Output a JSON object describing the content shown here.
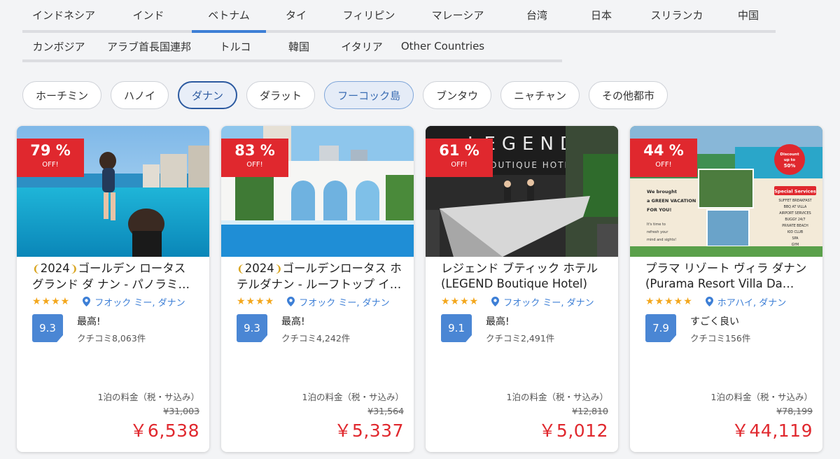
{
  "tabs_row1": [
    {
      "label": "インドネシア"
    },
    {
      "label": "インド"
    },
    {
      "label": "ベトナム",
      "active": true
    },
    {
      "label": "タイ"
    },
    {
      "label": "フィリピン"
    },
    {
      "label": "マレーシア"
    },
    {
      "label": "台湾"
    },
    {
      "label": "日本"
    },
    {
      "label": "スリランカ"
    },
    {
      "label": "中国"
    }
  ],
  "tabs_row2": [
    {
      "label": "カンボジア"
    },
    {
      "label": "アラブ首長国連邦"
    },
    {
      "label": "トルコ"
    },
    {
      "label": "韓国"
    },
    {
      "label": "イタリア"
    },
    {
      "label": "Other Countries"
    }
  ],
  "cities": [
    {
      "label": "ホーチミン",
      "state": "normal"
    },
    {
      "label": "ハノイ",
      "state": "normal"
    },
    {
      "label": "ダナン",
      "state": "active"
    },
    {
      "label": "ダラット",
      "state": "normal"
    },
    {
      "label": "フーコック島",
      "state": "soft"
    },
    {
      "label": "ブンタウ",
      "state": "normal"
    },
    {
      "label": "ニャチャン",
      "state": "normal"
    },
    {
      "label": "その他都市",
      "state": "normal"
    }
  ],
  "price_label": "1泊の料金（税・サ込み）",
  "off_label": "OFF!",
  "accent_color": "#e0282e",
  "link_color": "#3d7fd6",
  "hotels": [
    {
      "discount": "79 %",
      "award": "2024",
      "name": "ゴールデン ロータス グランド ダ ナン - パノラミック インフィニティプール",
      "stars": "★★★★",
      "location": "フオック ミー, ダナン",
      "score": "9.3",
      "rating_label": "最高!",
      "reviews": "クチコミ8,063件",
      "original_price": "¥31,003",
      "price": "￥6,538",
      "photo": "infinity-pool-with-child"
    },
    {
      "discount": "83 %",
      "award": "2024",
      "name": "ゴールデンロータス ホテルダナン - ルーフトップ インフィニティプール",
      "stars": "★★★★",
      "location": "フオック ミー, ダナン",
      "score": "9.3",
      "rating_label": "最高!",
      "reviews": "クチコミ4,242件",
      "original_price": "¥31,564",
      "price": "￥5,337",
      "photo": "rooftop-pool-arches"
    },
    {
      "discount": "61 %",
      "award": "",
      "name": "レジェンド ブティック ホテル (LEGEND Boutique Hotel)",
      "stars": "★★★★",
      "location": "フオック ミー, ダナン",
      "score": "9.1",
      "rating_label": "最高!",
      "reviews": "クチコミ2,491件",
      "original_price": "¥12,810",
      "price": "￥5,012",
      "photo": "hotel-lobby-reception",
      "photo_text": "LEGEND",
      "photo_subtext": "OUTIQUE HOTEL"
    },
    {
      "discount": "44 %",
      "award": "",
      "name": "プラマ リゾート ヴィラ ダナン (Purama Resort Villa Da Nang)",
      "stars": "★★★★★",
      "location": "ホアハイ, ダナン",
      "score": "7.9",
      "rating_label": "すごく良い",
      "reviews": "クチコミ156件",
      "original_price": "¥78,199",
      "price": "￥44,119",
      "photo": "resort-promo-collage",
      "promo": {
        "headline": [
          "We brought",
          "a GREEN VACATION",
          "FOR YOU!"
        ],
        "sub": [
          "It's time to",
          "refresh your",
          "mind and sights!"
        ],
        "badge": [
          "Discount",
          "up to",
          "50%"
        ],
        "services_title": "Special Services",
        "services": [
          "SUFFET BREAKFAST",
          "BBQ AT VILLA",
          "AIRPORT SERVICES",
          "BUGGY 24/7",
          "PRIVATE BEACH",
          "KID CLUB",
          "SPA",
          "GYM"
        ]
      }
    }
  ]
}
